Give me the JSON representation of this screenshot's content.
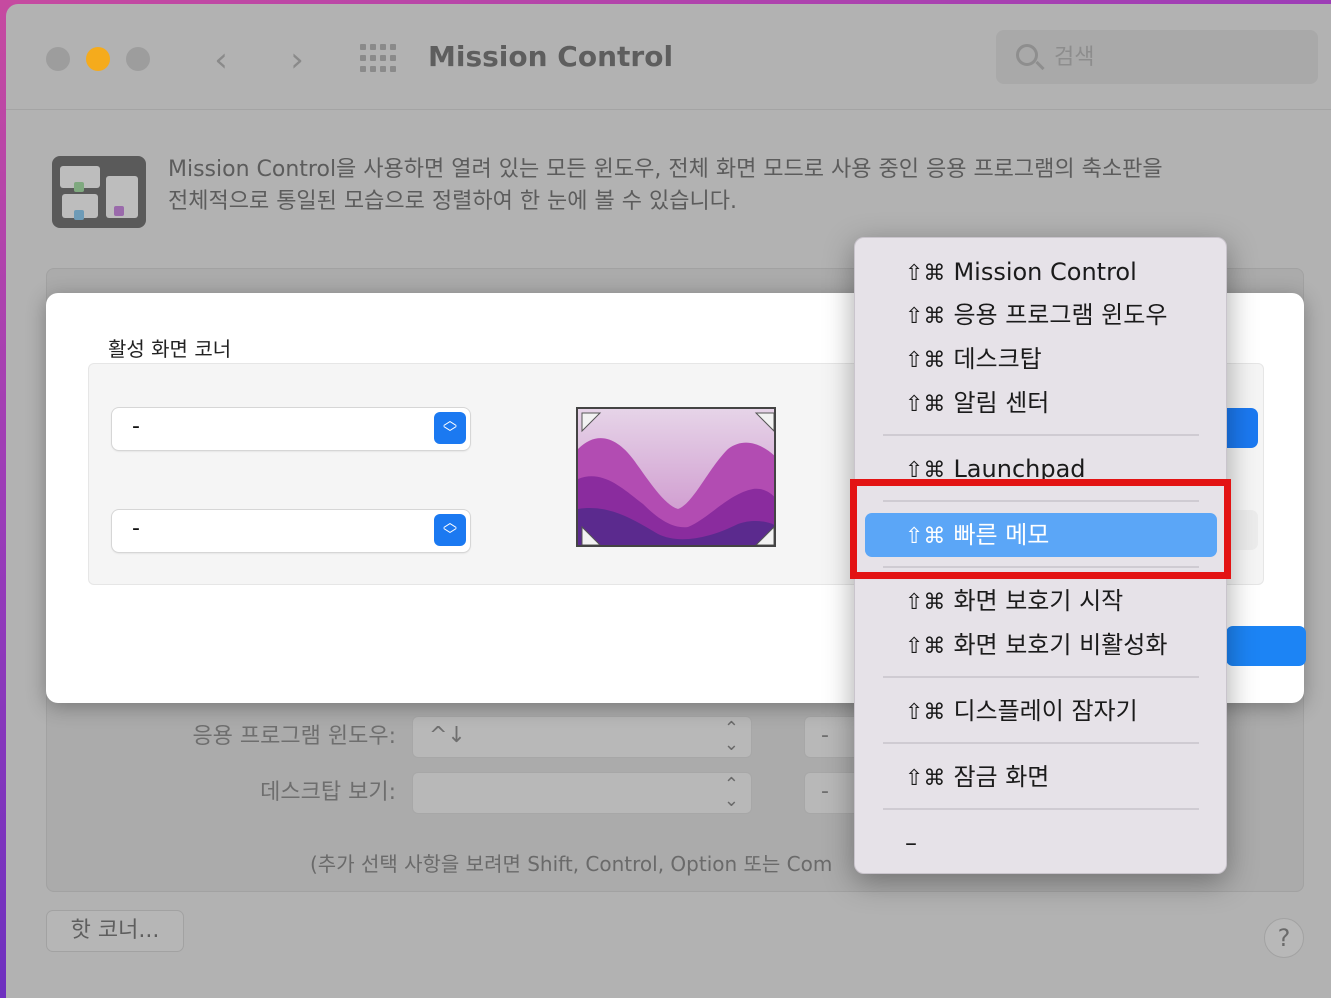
{
  "window": {
    "title": "Mission Control",
    "search_placeholder": "검색"
  },
  "description": {
    "line1": "Mission Control을 사용하면 열려 있는 모든 윈도우, 전체 화면 모드로 사용 중인 응용 프로그램의 축소판을",
    "line2": "전체적으로 통일된 모습으로 정렬하여 한 눈에 볼 수 있습니다."
  },
  "background": {
    "app_windows_label": "응용 프로그램 윈도우:",
    "app_windows_value": "^↓",
    "desktop_label": "데스크탑 보기:",
    "desktop_value": "",
    "right_dash_1": "-",
    "right_dash_2": "-",
    "hint": "(추가 선택 사항을 보려면 Shift, Control, Option 또는 Com",
    "hot_corners_button": "핫 코너...",
    "help": "?"
  },
  "sheet": {
    "title": "활성 화면 코너",
    "top_left_value": "-",
    "bottom_left_value": "-"
  },
  "menu": {
    "modifier": "⇧⌘",
    "items": [
      {
        "label": "Mission Control"
      },
      {
        "label": "응용 프로그램 윈도우"
      },
      {
        "label": "데스크탑"
      },
      {
        "label": "알림 센터"
      },
      {
        "label": "Launchpad"
      },
      {
        "label": "빠른 메모",
        "selected": true
      },
      {
        "label": "화면 보호기 시작"
      },
      {
        "label": "화면 보호기 비활성화"
      },
      {
        "label": "디스플레이 잠자기"
      },
      {
        "label": "잠금 화면"
      }
    ],
    "dash_item": "–"
  },
  "colors": {
    "accent": "#1b79f1",
    "highlight": "#e31414",
    "menu_selected": "#5ba6f7"
  }
}
